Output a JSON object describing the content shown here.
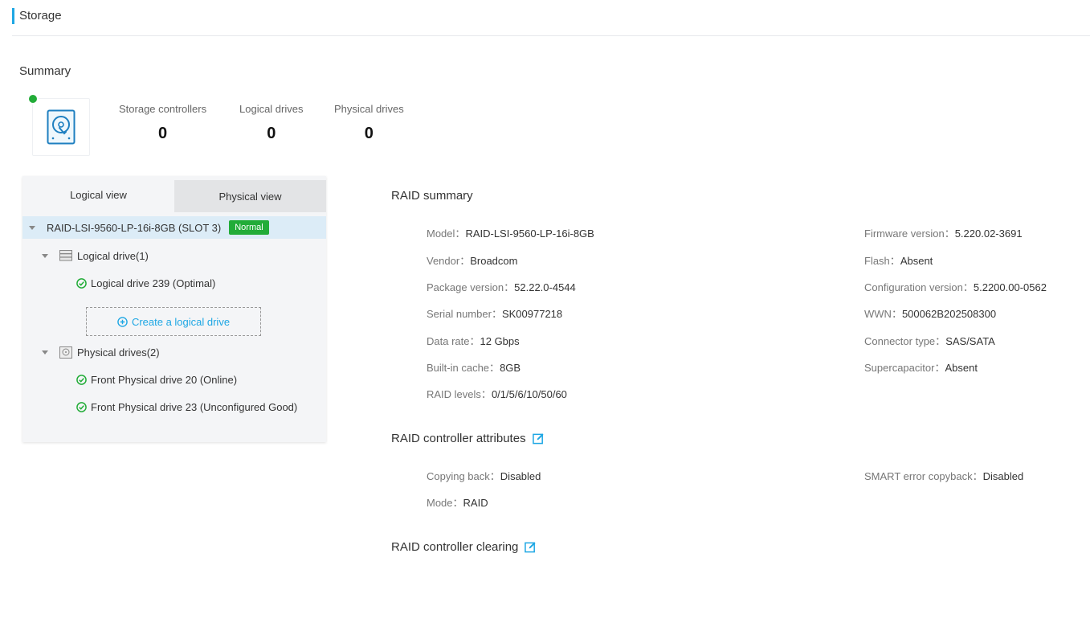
{
  "page": {
    "title": "Storage"
  },
  "summary": {
    "title": "Summary",
    "status_color": "#22ac38",
    "icon": "hard-disk-icon",
    "stats": [
      {
        "label": "Storage controllers",
        "value": "0"
      },
      {
        "label": "Logical drives",
        "value": "0"
      },
      {
        "label": "Physical drives",
        "value": "0"
      }
    ]
  },
  "tree": {
    "tabs": [
      {
        "label": "Logical view",
        "active": true
      },
      {
        "label": "Physical view",
        "active": false
      }
    ],
    "controller": {
      "label": "RAID-LSI-9560-LP-16i-8GB (SLOT 3)",
      "badge": "Normal"
    },
    "logical_group": {
      "label": "Logical drive(1)"
    },
    "logical_items": [
      {
        "label": "Logical drive 239 (Optimal)"
      }
    ],
    "create_button": "Create a logical drive",
    "physical_group": {
      "label": "Physical drives(2)"
    },
    "physical_items": [
      {
        "label": "Front Physical drive 20 (Online)"
      },
      {
        "label": "Front Physical drive 23 (Unconfigured Good)"
      }
    ]
  },
  "raid_summary": {
    "title": "RAID summary",
    "left": [
      {
        "key": "Model",
        "value": "RAID-LSI-9560-LP-16i-8GB"
      },
      {
        "key": "Vendor",
        "value": "Broadcom"
      },
      {
        "key": "Package version",
        "value": "52.22.0-4544"
      },
      {
        "key": "Serial number",
        "value": "SK00977218"
      },
      {
        "key": "Data rate",
        "value": "12 Gbps"
      },
      {
        "key": "Built-in cache",
        "value": "8GB"
      },
      {
        "key": "RAID levels",
        "value": "0/1/5/6/10/50/60"
      }
    ],
    "right": [
      {
        "key": "Firmware version",
        "value": "5.220.02-3691"
      },
      {
        "key": "Flash",
        "value": "Absent"
      },
      {
        "key": "Configuration version",
        "value": "5.2200.00-0562"
      },
      {
        "key": "WWN",
        "value": "500062B202508300"
      },
      {
        "key": "Connector type",
        "value": "SAS/SATA"
      },
      {
        "key": "Supercapacitor",
        "value": "Absent"
      }
    ]
  },
  "controller_attributes": {
    "title": "RAID controller attributes",
    "left": [
      {
        "key": "Copying back",
        "value": "Disabled"
      },
      {
        "key": "Mode",
        "value": "RAID"
      }
    ],
    "right": [
      {
        "key": "SMART error copyback",
        "value": "Disabled"
      }
    ]
  },
  "controller_clearing": {
    "title": "RAID controller clearing"
  },
  "colors": {
    "accent": "#1ea7e4",
    "ok": "#22ac38"
  },
  "separator": "："
}
